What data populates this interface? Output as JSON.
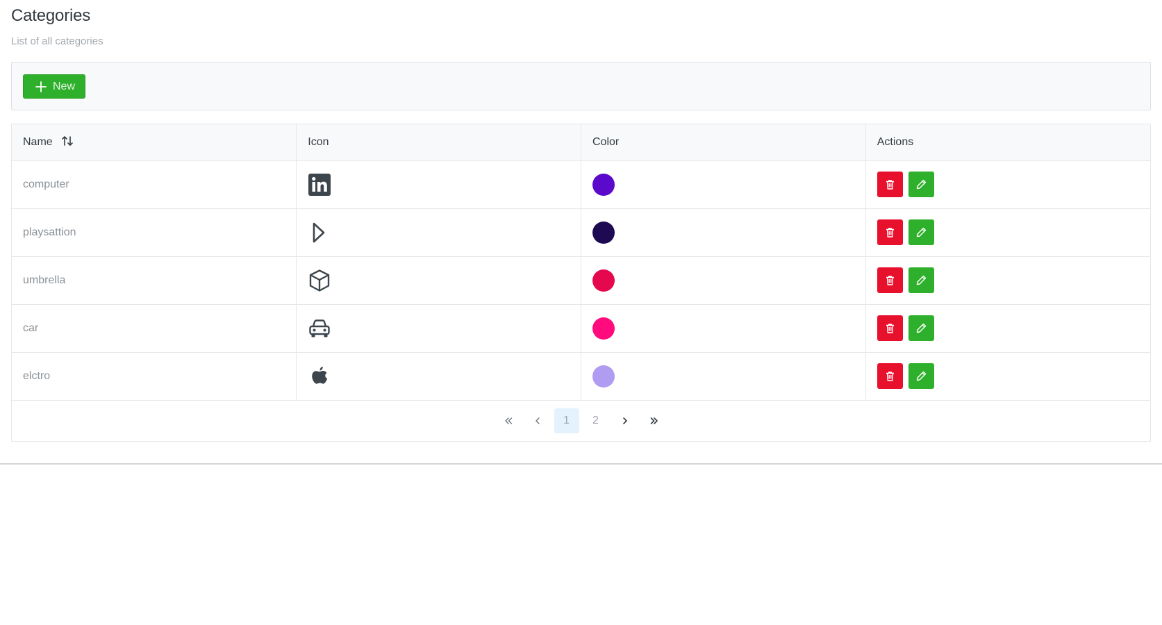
{
  "header": {
    "title": "Categories",
    "subtitle": "List of all categories"
  },
  "toolbar": {
    "new_label": "New"
  },
  "table": {
    "columns": [
      "Name",
      "Icon",
      "Color",
      "Actions"
    ],
    "rows": [
      {
        "name": "computer",
        "icon": "linkedin-icon",
        "color": "#5b0acc"
      },
      {
        "name": "playsattion",
        "icon": "play-triangle-icon",
        "color": "#1e0a52"
      },
      {
        "name": "umbrella",
        "icon": "box-icon",
        "color": "#e5084f"
      },
      {
        "name": "car",
        "icon": "car-icon",
        "color": "#ff0b7e"
      },
      {
        "name": "elctro",
        "icon": "apple-icon",
        "color": "#b09cf0"
      }
    ]
  },
  "pagination": {
    "pages": [
      "1",
      "2"
    ],
    "current": "1"
  },
  "colors": {
    "primary_green": "#2fb02c",
    "danger_red": "#e8112d",
    "pagination_active_bg": "#e3f2fd"
  }
}
